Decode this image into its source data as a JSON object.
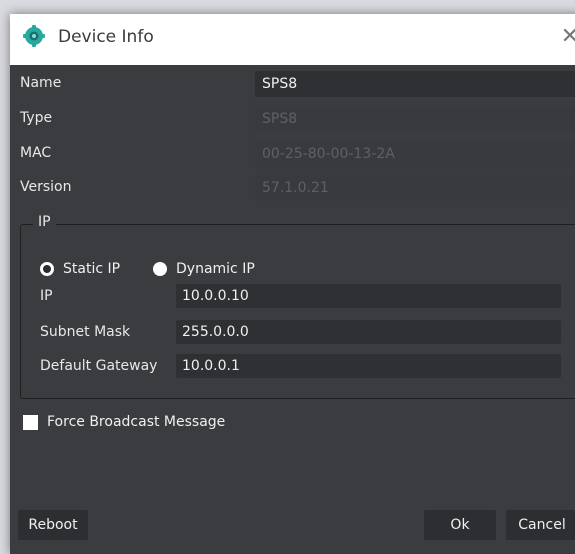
{
  "window": {
    "title": "Device Info",
    "close_glyph": "✕"
  },
  "device": {
    "name_label": "Name",
    "name_value": "SPS8",
    "type_label": "Type",
    "type_value": "SPS8",
    "mac_label": "MAC",
    "mac_value": "00-25-80-00-13-2A",
    "version_label": "Version",
    "version_value": "57.1.0.21"
  },
  "ip_group": {
    "title": "IP",
    "static_label": "Static IP",
    "dynamic_label": "Dynamic IP",
    "selected_mode": "Static IP",
    "ip_label": "IP",
    "ip_value": "10.0.0.10",
    "subnet_label": "Subnet Mask",
    "subnet_value": "255.0.0.0",
    "gateway_label": "Default Gateway",
    "gateway_value": "10.0.0.1"
  },
  "options": {
    "force_broadcast_label": "Force Broadcast Message",
    "force_broadcast_checked": false
  },
  "buttons": {
    "reboot": "Reboot",
    "ok": "Ok",
    "cancel": "Cancel"
  },
  "icons": {
    "app": "device-gear-icon",
    "close": "close-icon"
  },
  "colors": {
    "dialog_bg": "#3b3c40",
    "field_bg": "#2f3034",
    "titlebar_bg": "#ffffff",
    "icon_teal": "#27a9a0"
  }
}
